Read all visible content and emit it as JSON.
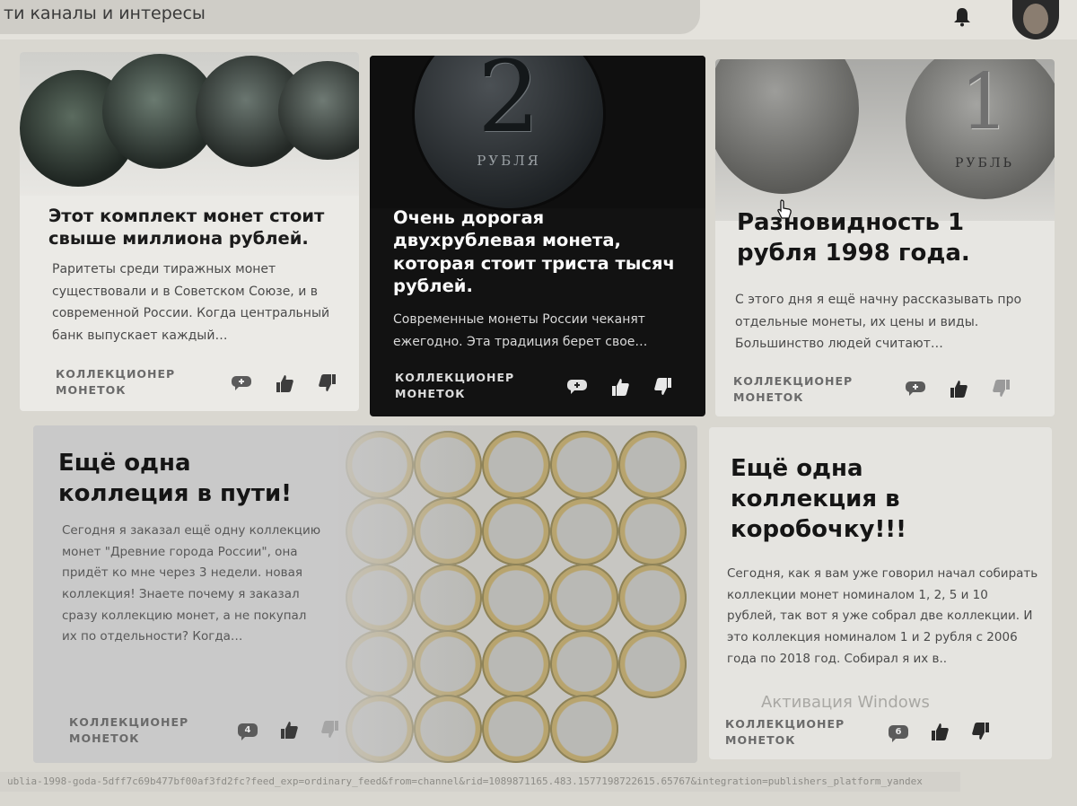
{
  "header": {
    "search_text": "ти каналы и интересы"
  },
  "cards": [
    {
      "title": "Этот комплект монет стоит свыше миллиона рублей.",
      "text": "Раритеты среди тиражных монет существовали и в Советском Союзе, и в современной России. Когда центральный банк выпускает каждый…",
      "author_line1": "КОЛЛЕКЦИОНЕР",
      "author_line2": "МОНЕТОК",
      "comment_icon": "comment-icon"
    },
    {
      "title": "Очень дорогая двухрублевая монета, которая стоит триста тысяч рублей.",
      "text": "Современные монеты России чеканят ежегодно. Эта традиция берет свое…",
      "author_line1": "КОЛЛЕКЦИОНЕР",
      "author_line2": "МОНЕТОК",
      "coin_value": "2",
      "coin_word": "РУБЛЯ"
    },
    {
      "title": "Разновидность 1 рубля 1998 года.",
      "text": "С этого дня я ещё начну рассказывать про отдельные монеты, их цены и виды. Большинство людей считают…",
      "author_line1": "КОЛЛЕКЦИОНЕР",
      "author_line2": "МОНЕТОК",
      "coin_value": "1",
      "coin_word": "РУБЛЬ"
    },
    {
      "title": "Ещё одна коллеция в пути!",
      "text": "Сегодня я заказал ещё одну коллекцию монет \"Древние города России\", она придёт ко мне через 3 недели. новая коллекция! Знаете почему я заказал сразу коллекцию монет, а не покупал их по отдельности? Когда…",
      "author_line1": "КОЛЛЕКЦИОНЕР",
      "author_line2": "МОНЕТОК",
      "comment_count": "4"
    },
    {
      "title": "Ещё одна коллекция в коробочку!!!",
      "text": "Сегодня, как я вам уже говорил начал собирать коллекции монет номиналом 1, 2, 5 и 10 рублей, так вот я уже собрал две коллекции. И это коллекция номиналом 1 и 2 рубля с 2006 года по 2018 год. Собирал я их в..",
      "author_line1": "КОЛЛЕКЦИОНЕР",
      "author_line2": "МОНЕТОК",
      "comment_count": "6"
    }
  ],
  "watermark": "Активация Windows",
  "status_url": "ublia-1998-goda-5dff7c69b477bf00af3fd2fc?feed_exp=ordinary_feed&from=channel&rid=1089871165.483.1577198722615.65767&integration=publishers_platform_yandex",
  "colors": {
    "dark_card": "#121212",
    "light_card": "#e9e8e4",
    "page_bg": "#d9d7d0"
  }
}
